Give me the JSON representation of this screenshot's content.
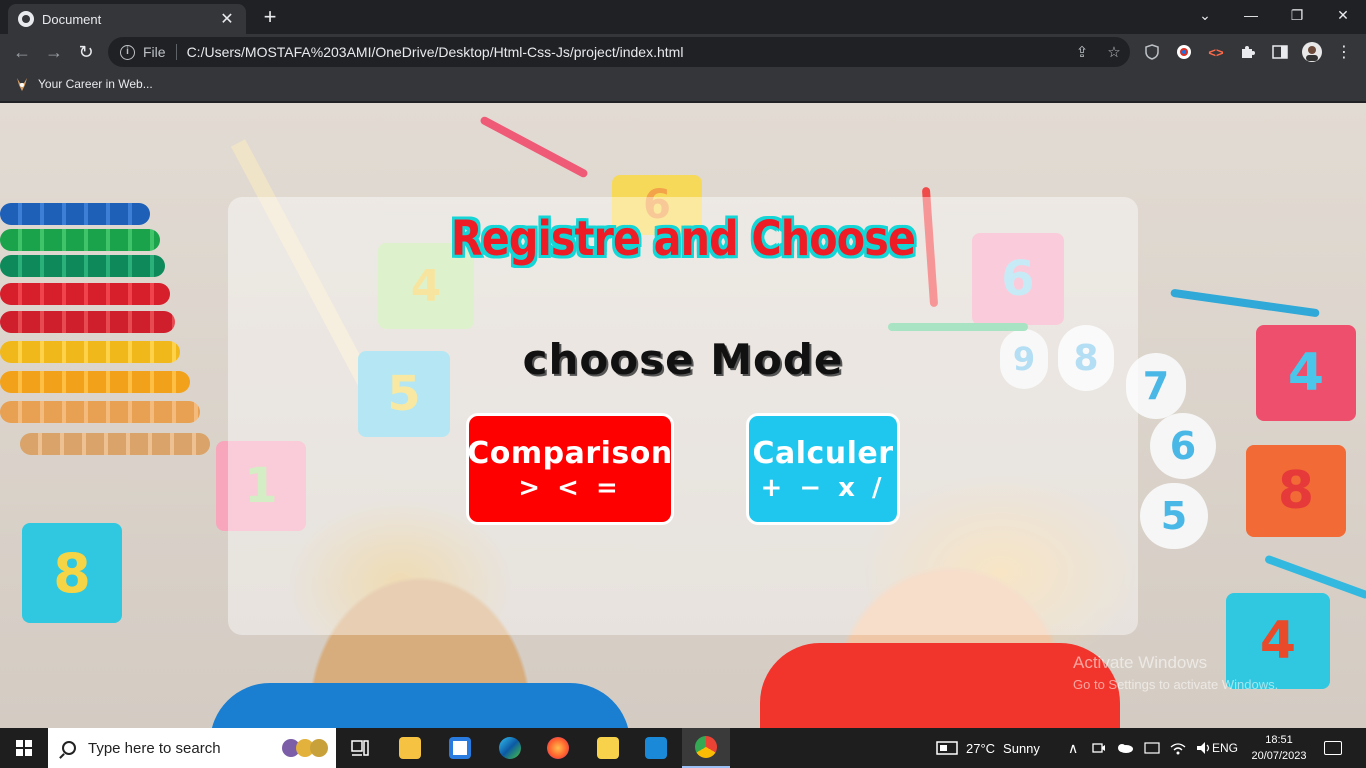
{
  "browser": {
    "tab_title": "Document",
    "tab_close": "✕",
    "new_tab": "+",
    "window_controls": {
      "menu": "⌄",
      "minimize": "—",
      "restore": "❐",
      "close": "✕"
    },
    "nav": {
      "back": "←",
      "forward": "→",
      "reload": "↻"
    },
    "omnibox": {
      "info_icon": "i",
      "scheme_label": "File",
      "url": "C:/Users/MOSTAFA%203AMI/OneDrive/Desktop/Html-Css-Js/project/index.html",
      "share_icon": "⇪",
      "star_icon": "☆"
    },
    "extensions": [
      "shield-extension",
      "circle-extension",
      "code-extension",
      "puzzle-extension",
      "sidepanel",
      "profile",
      "menu"
    ],
    "bookmark": {
      "label": "Your Career in Web..."
    }
  },
  "page": {
    "heading": "Registre and Choose",
    "subheading": "choose Mode",
    "modes": [
      {
        "label": "Comparison",
        "symbols": "> < =",
        "color": "#ff0000"
      },
      {
        "label": "Calculer",
        "symbols": "+ − x /",
        "color": "#1fc7ef"
      }
    ],
    "background_puzzle_numbers": [
      "4",
      "6",
      "6",
      "5",
      "1",
      "8",
      "4",
      "8",
      "9",
      "8",
      "7",
      "6",
      "5",
      "4"
    ]
  },
  "watermark": {
    "title": "Activate Windows",
    "subtitle": "Go to Settings to activate Windows."
  },
  "taskbar": {
    "search_placeholder": "Type here to search",
    "weather": {
      "temp": "27°C",
      "condition": "Sunny"
    },
    "language": "ENG",
    "time": "18:51",
    "date": "20/07/2023",
    "tray_chevron": "∧"
  }
}
